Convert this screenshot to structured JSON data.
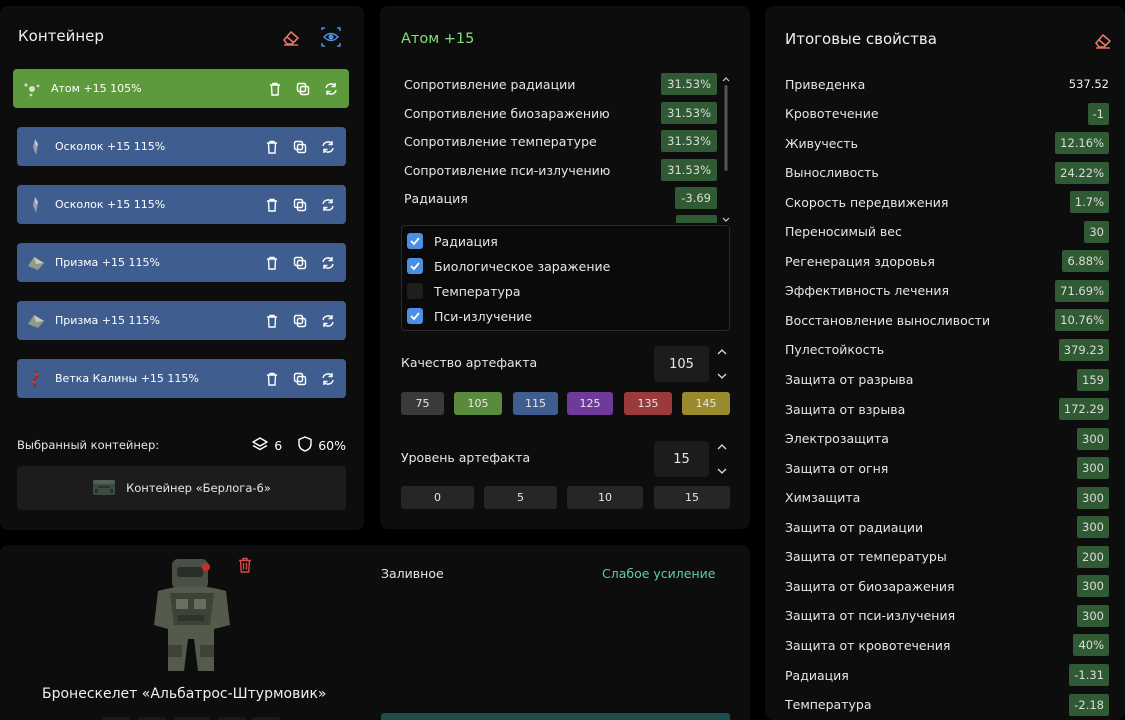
{
  "container_panel": {
    "title": "Контейнер",
    "artifacts": [
      {
        "label": "Атом  +15  105%",
        "active": true
      },
      {
        "label": "Осколок  +15  115%",
        "active": false
      },
      {
        "label": "Осколок  +15  115%",
        "active": false
      },
      {
        "label": "Призма  +15  115%",
        "active": false
      },
      {
        "label": "Призма  +15  115%",
        "active": false
      },
      {
        "label": "Ветка Калины  +15  115%",
        "active": false
      }
    ],
    "selected_label": "Выбранный контейнер:",
    "slots": "6",
    "protection": "60%",
    "container_name": "Контейнер «Берлога-6»"
  },
  "artifact_panel": {
    "title": "Атом +15",
    "properties": [
      {
        "name": "Сопротивление радиации",
        "value": "31.53%"
      },
      {
        "name": "Сопротивление биозаражению",
        "value": "31.53%"
      },
      {
        "name": "Сопротивление температуре",
        "value": "31.53%"
      },
      {
        "name": "Сопротивление пси-излучению",
        "value": "31.53%"
      },
      {
        "name": "Радиация",
        "value": "-3.69"
      }
    ],
    "checklist": [
      {
        "label": "Радиация",
        "checked": true
      },
      {
        "label": "Биологическое заражение",
        "checked": true
      },
      {
        "label": "Температура",
        "checked": false
      },
      {
        "label": "Пси-излучение",
        "checked": true
      }
    ],
    "quality_label": "Качество артефакта",
    "quality_value": "105",
    "quality_options": [
      {
        "label": "75",
        "color": "#3a3a3a"
      },
      {
        "label": "105",
        "color": "#5a8a3c"
      },
      {
        "label": "115",
        "color": "#3f5e8f"
      },
      {
        "label": "125",
        "color": "#6f3a9a"
      },
      {
        "label": "135",
        "color": "#9a3a3a"
      },
      {
        "label": "145",
        "color": "#9a8a2e"
      }
    ],
    "level_label": "Уровень артефакта",
    "level_value": "15",
    "level_options": [
      "0",
      "5",
      "10",
      "15"
    ]
  },
  "summary_panel": {
    "title": "Итоговые свойства",
    "stats": [
      {
        "name": "Приведенка",
        "value": "537.52",
        "plain": true
      },
      {
        "name": "Кровотечение",
        "value": "-1"
      },
      {
        "name": "Живучесть",
        "value": "12.16%"
      },
      {
        "name": "Выносливость",
        "value": "24.22%"
      },
      {
        "name": "Скорость передвижения",
        "value": "1.7%"
      },
      {
        "name": "Переносимый вес",
        "value": "30"
      },
      {
        "name": "Регенерация здоровья",
        "value": "6.88%"
      },
      {
        "name": "Эффективность лечения",
        "value": "71.69%"
      },
      {
        "name": "Восстановление выносливости",
        "value": "10.76%"
      },
      {
        "name": "Пулестойкость",
        "value": "379.23"
      },
      {
        "name": "Защита от разрыва",
        "value": "159"
      },
      {
        "name": "Защита от взрыва",
        "value": "172.29"
      },
      {
        "name": "Электрозащита",
        "value": "300"
      },
      {
        "name": "Защита от огня",
        "value": "300"
      },
      {
        "name": "Химзащита",
        "value": "300"
      },
      {
        "name": "Защита от радиации",
        "value": "300"
      },
      {
        "name": "Защита от температуры",
        "value": "200"
      },
      {
        "name": "Защита от биозаражения",
        "value": "300"
      },
      {
        "name": "Защита от пси-излучения",
        "value": "300"
      },
      {
        "name": "Защита от кровотечения",
        "value": "40%"
      },
      {
        "name": "Радиация",
        "value": "-1.31"
      },
      {
        "name": "Температура",
        "value": "-2.18"
      }
    ]
  },
  "armor_panel": {
    "name": "Бронескелет «Альбатрос-Штурмовик»",
    "fill_label": "Заливное",
    "boost_link": "Слабое усиление"
  },
  "colors": {
    "active_green": "#5c9a3c",
    "item_blue": "#3f5e8f",
    "value_green": "#2f5a33",
    "title_green": "#7ee27a",
    "accent_blue": "#4a90e2",
    "link_green": "#5ed09a"
  }
}
